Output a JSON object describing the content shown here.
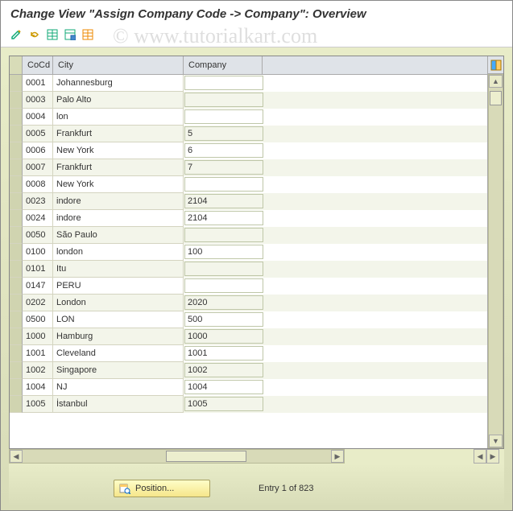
{
  "title": "Change View \"Assign Company Code -> Company\": Overview",
  "watermark": "© www.tutorialkart.com",
  "toolbar": {
    "icons": [
      "edit-icon",
      "undo-icon",
      "table-green-icon",
      "table-save-icon",
      "table-orange-icon"
    ]
  },
  "table": {
    "columns": {
      "cocd": "CoCd",
      "city": "City",
      "company": "Company"
    },
    "rows": [
      {
        "cocd": "0001",
        "city": "Johannesburg",
        "company": ""
      },
      {
        "cocd": "0003",
        "city": "Palo Alto",
        "company": ""
      },
      {
        "cocd": "0004",
        "city": "lon",
        "company": ""
      },
      {
        "cocd": "0005",
        "city": "Frankfurt",
        "company": "5"
      },
      {
        "cocd": "0006",
        "city": "New York",
        "company": "6"
      },
      {
        "cocd": "0007",
        "city": "Frankfurt",
        "company": "7"
      },
      {
        "cocd": "0008",
        "city": "New York",
        "company": ""
      },
      {
        "cocd": "0023",
        "city": "indore",
        "company": "2104"
      },
      {
        "cocd": "0024",
        "city": "indore",
        "company": "2104"
      },
      {
        "cocd": "0050",
        "city": "São Paulo",
        "company": ""
      },
      {
        "cocd": "0100",
        "city": "london",
        "company": "100"
      },
      {
        "cocd": "0101",
        "city": "Itu",
        "company": ""
      },
      {
        "cocd": "0147",
        "city": "PERU",
        "company": ""
      },
      {
        "cocd": "0202",
        "city": "London",
        "company": "2020"
      },
      {
        "cocd": "0500",
        "city": "LON",
        "company": "500"
      },
      {
        "cocd": "1000",
        "city": "Hamburg",
        "company": "1000"
      },
      {
        "cocd": "1001",
        "city": "Cleveland",
        "company": "1001"
      },
      {
        "cocd": "1002",
        "city": "Singapore",
        "company": "1002"
      },
      {
        "cocd": "1004",
        "city": "NJ",
        "company": "1004"
      },
      {
        "cocd": "1005",
        "city": "İstanbul",
        "company": "1005"
      }
    ]
  },
  "footer": {
    "position_label": "Position...",
    "entry_text": "Entry 1 of 823"
  }
}
